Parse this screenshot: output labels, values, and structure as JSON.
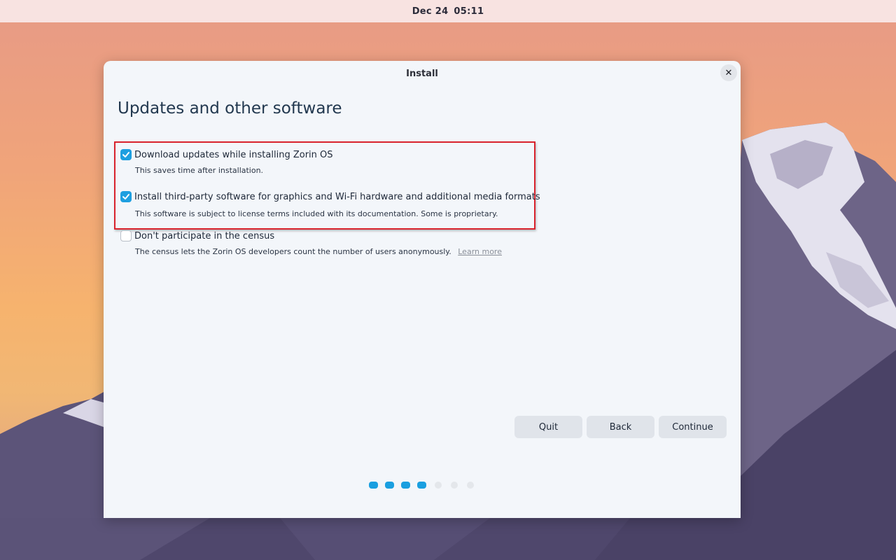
{
  "topbar": {
    "date": "Dec 24",
    "time": "05:11"
  },
  "window": {
    "title": "Install"
  },
  "page": {
    "title": "Updates and other software"
  },
  "options": [
    {
      "label": "Download updates while installing Zorin OS",
      "description": "This saves time after installation.",
      "checked": true
    },
    {
      "label": "Install third-party software for graphics and Wi-Fi hardware and additional media formats",
      "description": "This software is subject to license terms included with its documentation. Some is proprietary.",
      "checked": true
    },
    {
      "label": "Don't participate in the census",
      "description": "The census lets the Zorin OS developers count the number of users anonymously.",
      "link": "Learn more",
      "checked": false
    }
  ],
  "buttons": {
    "quit": "Quit",
    "back": "Back",
    "continue": "Continue"
  },
  "progress": {
    "current_step": 4,
    "total_steps": 7
  },
  "colors": {
    "accent": "#1e9fe0",
    "highlight": "#d9232d"
  }
}
